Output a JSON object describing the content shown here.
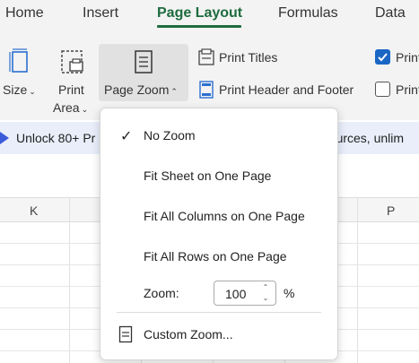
{
  "tabs": {
    "home": "Home",
    "insert": "Insert",
    "page_layout": "Page Layout",
    "formulas": "Formulas",
    "data": "Data"
  },
  "ribbon": {
    "size_label": "Size",
    "print_area_line1": "Print",
    "print_area_line2": "Area",
    "page_zoom_label": "Page Zoom",
    "print_titles": "Print Titles",
    "print_header_footer": "Print Header and Footer",
    "print_checkbox_1": "Print",
    "print_checkbox_2": "Print",
    "print_checkbox_1_checked": true,
    "print_checkbox_2_checked": false
  },
  "banner": {
    "text_left": "Unlock 80+ Pr",
    "text_right": "esources, unlim"
  },
  "sheet": {
    "col_left": "K",
    "col_right": "P"
  },
  "zoom_menu": {
    "items": [
      {
        "label": "No Zoom",
        "checked": true
      },
      {
        "label": "Fit Sheet on One Page",
        "checked": false
      },
      {
        "label": "Fit All Columns on One Page",
        "checked": false
      },
      {
        "label": "Fit All Rows on One Page",
        "checked": false
      }
    ],
    "zoom_label": "Zoom:",
    "zoom_value": "100",
    "zoom_unit": "%",
    "custom_zoom": "Custom Zoom..."
  },
  "colors": {
    "accent_green": "#1e6b3e",
    "checkbox_blue": "#1a66c5",
    "icon_blue": "#2b6fd0",
    "banner_bg": "#e9eefa"
  }
}
